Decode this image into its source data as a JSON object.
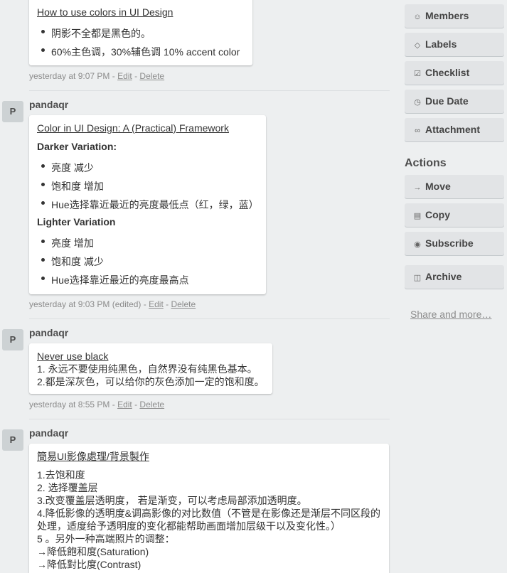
{
  "comments": [
    {
      "card_title": "How to use colors in UI Design",
      "bullets": [
        "阴影不全都是黑色的。",
        "60%主色调，30%辅色调 10% accent color"
      ],
      "meta": {
        "timestamp": "yesterday at 9:07 PM",
        "sep1": " - ",
        "edit": "Edit",
        "sep2": " - ",
        "delete": "Delete"
      }
    },
    {
      "avatar": "P",
      "author": "pandaqr",
      "card_title": "Color in UI Design: A (Practical) Framework",
      "darker_heading": "Darker Variation:",
      "darker_bullets": [
        "亮度 减少",
        "饱和度 增加",
        "Hue选择靠近最近的亮度最低点（红，绿，蓝）"
      ],
      "lighter_heading": "Lighter Variation",
      "lighter_bullets": [
        "亮度 增加",
        "饱和度 减少",
        "Hue选择靠近最近的亮度最高点"
      ],
      "meta": {
        "timestamp": "yesterday at 9:03 PM (edited)",
        "sep1": " - ",
        "edit": "Edit",
        "sep2": " - ",
        "delete": "Delete"
      }
    },
    {
      "avatar": "P",
      "author": "pandaqr",
      "card_title": "Never use black",
      "lines": [
        "1. 永远不要使用纯黑色，自然界没有纯黑色基本。",
        "2.都是深灰色，可以给你的灰色添加一定的饱和度。"
      ],
      "meta": {
        "timestamp": "yesterday at 8:55 PM",
        "sep1": " - ",
        "edit": "Edit",
        "sep2": " - ",
        "delete": "Delete"
      }
    },
    {
      "avatar": "P",
      "author": "pandaqr",
      "card_title": "簡易UI影像處理/背景製作",
      "lines": [
        "1.去饱和度",
        "2. 选择覆盖层",
        "3.改变覆盖层透明度， 若是渐变，可以考虑局部添加透明度。",
        "4.降低影像的透明度&调高影像的对比数值（不管是在影像还是渐层不同区段的",
        "处理，适度给予透明度的变化都能帮助画面增加层级干以及变化性。）",
        "5 。另外一种高端照片的调整：",
        "→降低飽和度(Saturation)",
        "→降低對比度(Contrast)"
      ]
    }
  ],
  "sidebar": {
    "add_buttons": [
      {
        "label": "Members",
        "icon": "person-icon"
      },
      {
        "label": "Labels",
        "icon": "tag-icon"
      },
      {
        "label": "Checklist",
        "icon": "checkbox-icon"
      },
      {
        "label": "Due Date",
        "icon": "clock-icon"
      },
      {
        "label": "Attachment",
        "icon": "paperclip-icon"
      }
    ],
    "actions_heading": "Actions",
    "action_buttons": [
      {
        "label": "Move",
        "icon": "arrow-right-icon"
      },
      {
        "label": "Copy",
        "icon": "card-icon"
      },
      {
        "label": "Subscribe",
        "icon": "eye-icon"
      },
      {
        "label": "Archive",
        "icon": "archive-icon"
      }
    ],
    "share_link": "Share and more…"
  },
  "colors": {
    "background": "#edeff0",
    "card": "#ffffff",
    "button": "#e2e4e6",
    "meta_text": "#8c8c8c"
  }
}
